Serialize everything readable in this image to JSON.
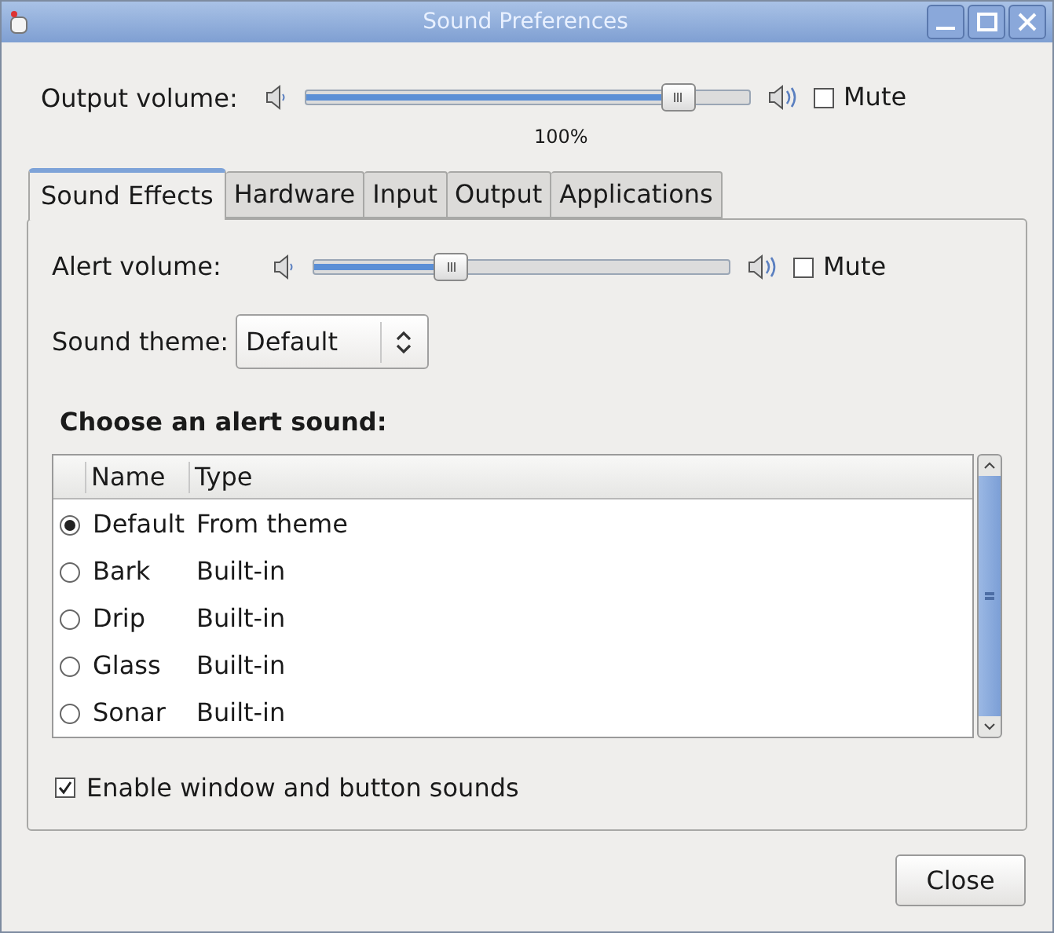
{
  "window": {
    "title": "Sound Preferences"
  },
  "output": {
    "label": "Output volume:",
    "level": 0.84,
    "reading": "100%",
    "mute": {
      "label": "Mute",
      "checked": false
    }
  },
  "tabs": [
    {
      "label": "Sound Effects",
      "selected": true
    },
    {
      "label": "Hardware",
      "selected": false
    },
    {
      "label": "Input",
      "selected": false
    },
    {
      "label": "Output",
      "selected": false
    },
    {
      "label": "Applications",
      "selected": false
    }
  ],
  "alert": {
    "label": "Alert volume:",
    "level": 0.33,
    "mute": {
      "label": "Mute",
      "checked": false
    }
  },
  "sound_theme": {
    "label": "Sound theme:",
    "value": "Default"
  },
  "alert_sounds": {
    "heading": "Choose an alert sound:",
    "columns": [
      "Name",
      "Type"
    ],
    "rows": [
      {
        "name": "Default",
        "type": "From theme",
        "selected": true
      },
      {
        "name": "Bark",
        "type": "Built-in",
        "selected": false
      },
      {
        "name": "Drip",
        "type": "Built-in",
        "selected": false
      },
      {
        "name": "Glass",
        "type": "Built-in",
        "selected": false
      },
      {
        "name": "Sonar",
        "type": "Built-in",
        "selected": false
      }
    ]
  },
  "enable_sounds": {
    "label": "Enable window and button sounds",
    "checked": true
  },
  "buttons": [
    "Close"
  ]
}
